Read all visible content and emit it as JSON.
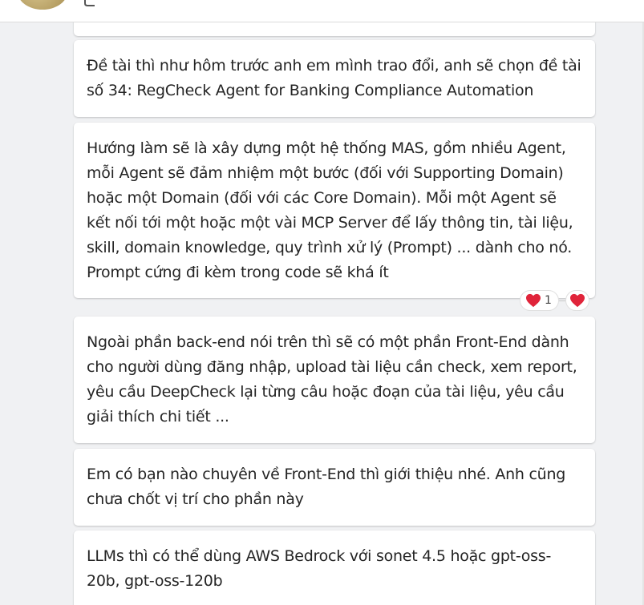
{
  "messages": [
    {
      "text": ""
    },
    {
      "text": "Đề tài thì như hôm trước anh em mình trao đổi, anh sẽ chọn đề tài\nsố 34: RegCheck Agent for Banking Compliance Automation"
    },
    {
      "text": "Hướng làm sẽ là xây dựng một hệ thống MAS, gồm nhiều Agent,\nmỗi Agent sẽ đảm nhiệm một bước (đối với Supporting Domain)\nhoặc một Domain (đối với các Core Domain). Mỗi một Agent sẽ\nkết nối tới một hoặc một vài MCP Server để lấy thông tin, tài liệu,\nskill, domain knowledge, quy trình xử lý (Prompt) ... dành cho nó.\nPrompt cứng đi kèm trong code sẽ khá ít"
    },
    {
      "text": "Ngoài phần back-end nói trên thì sẽ có một phần Front-End dành\ncho người dùng đăng nhập, upload tài liệu cần check, xem report,\nyêu cầu DeepCheck lại từng câu hoặc đoạn của tài liệu, yêu cầu\ngiải thích chi tiết ..."
    },
    {
      "text": "Em có bạn nào chuyên về Front-End thì giới thiệu nhé. Anh cũng\nchưa chốt vị trí cho phần này"
    },
    {
      "text": "LLMs thì có thể dùng AWS Bedrock với sonet 4.5 hoặc gpt-oss-\n20b, gpt-oss-120b"
    }
  ],
  "reactions": {
    "heart_count": "1",
    "heart_icon": "heart-icon",
    "add_icon": "add-heart-reaction-icon",
    "color": "#e0243a"
  },
  "colors": {
    "background": "#f0f1f3",
    "card": "#ffffff",
    "text": "#242424"
  }
}
